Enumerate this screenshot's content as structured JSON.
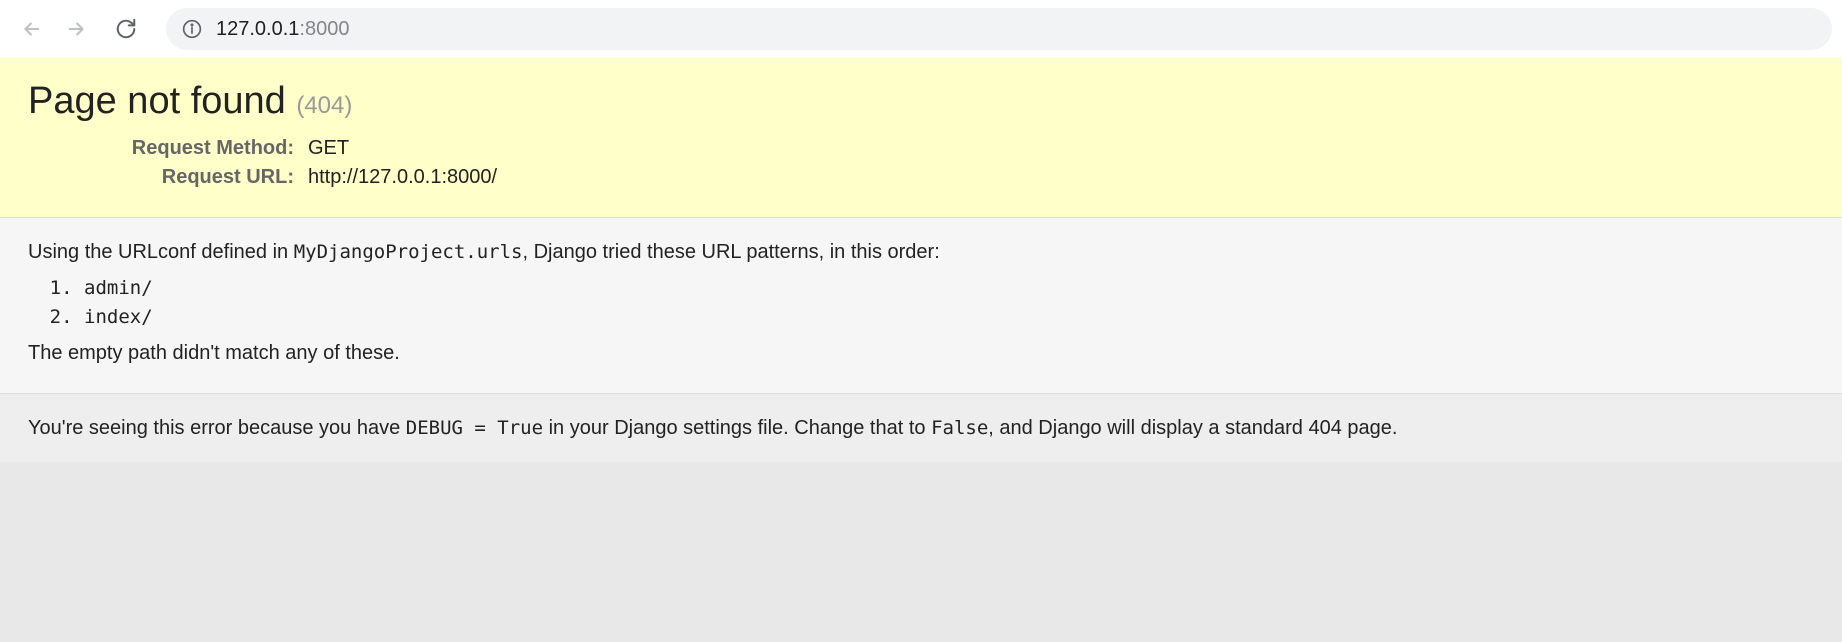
{
  "browser": {
    "url_host": "127.0.0.1",
    "url_port": ":8000"
  },
  "header": {
    "title": "Page not found ",
    "status": "(404)",
    "meta": {
      "request_method_label": "Request Method:",
      "request_method_value": "GET",
      "request_url_label": "Request URL:",
      "request_url_value": "http://127.0.0.1:8000/"
    }
  },
  "info": {
    "intro_prefix": "Using the URLconf defined in ",
    "intro_code": "MyDjangoProject.urls",
    "intro_suffix": ", Django tried these URL patterns, in this order:",
    "patterns": [
      "admin/",
      "index/"
    ],
    "no_match": "The empty path didn't match any of these."
  },
  "explanation": {
    "prefix": "You're seeing this error because you have ",
    "debug_code": "DEBUG = True",
    "middle": " in your Django settings file. Change that to ",
    "false_code": "False",
    "suffix": ", and Django will display a standard 404 page."
  }
}
